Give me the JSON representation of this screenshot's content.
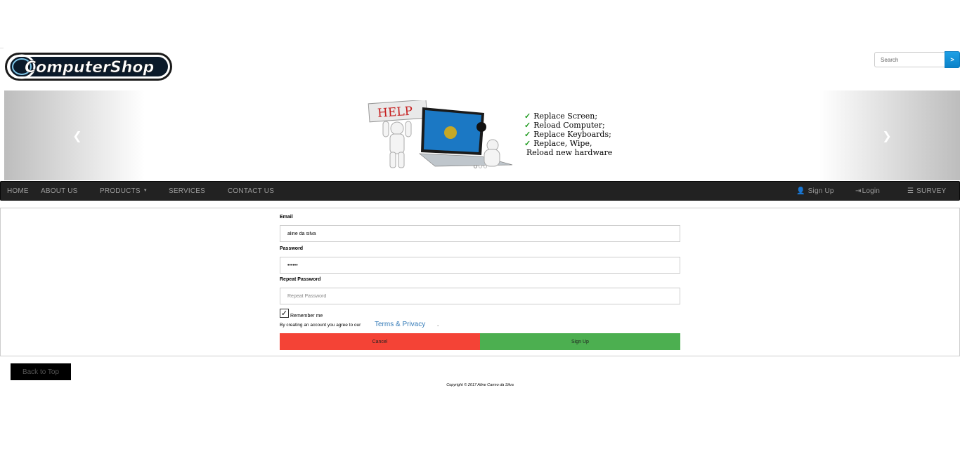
{
  "brand": {
    "logo_text": "ComputerShop"
  },
  "search": {
    "placeholder": "Search",
    "button_label": ">"
  },
  "carousel": {
    "prev_icon": "chevron-left-icon",
    "next_icon": "chevron-right-icon",
    "slide": {
      "sign_text": "HELP",
      "lines": [
        "Replace Screen;",
        "Reload Computer;",
        "Replace Keyboards;",
        "Replace, Wipe,",
        "Reload new hardware"
      ]
    },
    "indicator_count": 3,
    "active_indicator": 0
  },
  "navbar": {
    "home": "HOME",
    "about": "ABOUT US",
    "products": "PRODUCTS",
    "services": "SERVICES",
    "contact": "CONTACT US",
    "signup": "Sign Up",
    "login": "Login",
    "survey": "SURVEY"
  },
  "form": {
    "email_label": "Email",
    "email_value": "aline da silva",
    "password_label": "Password",
    "password_value": "••••••",
    "repeat_label": "Repeat Password",
    "repeat_placeholder": "Repeat Password",
    "remember_label": "Remember me",
    "remember_checked": true,
    "agree_text": "By creating an account you agree to our",
    "terms_link": "Terms & Privacy",
    "terms_suffix": ".",
    "cancel_label": "Cancel",
    "signup_label": "Sign Up"
  },
  "footer": {
    "back_to_top": "Back to Top",
    "copyright": "Copyright © 2017 Aline Carmo da Silva"
  },
  "colors": {
    "navbar_bg": "#222222",
    "cancel_bg": "#f44336",
    "signup_bg": "#4caf50",
    "link": "#337ab7",
    "search_btn": "#1ea0e6"
  }
}
